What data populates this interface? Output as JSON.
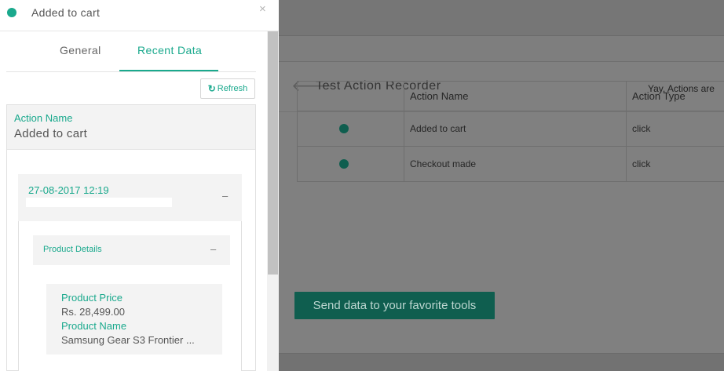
{
  "panel": {
    "title": "Added to cart",
    "close": "×",
    "tabs": [
      "General",
      "Recent Data"
    ],
    "refresh_label": "Refresh",
    "action_name_label": "Action Name",
    "action_name_value": "Added to cart",
    "entry": {
      "timestamp": "27-08-2017 12:19",
      "toggle": "–",
      "section": {
        "title": "Product Details",
        "toggle": "–",
        "fields": [
          {
            "label": "Product Price",
            "value": "Rs. 28,499.00"
          },
          {
            "label": "Product Name",
            "value": "Samsung Gear S3 Frontier ..."
          }
        ]
      }
    }
  },
  "page": {
    "title": "Test Action Recorder",
    "status": "Yay, Actions are",
    "table": {
      "headers": [
        "",
        "Action Name",
        "Action Type"
      ],
      "rows": [
        {
          "name": "Added to cart",
          "type": "click"
        },
        {
          "name": "Checkout made",
          "type": "click"
        }
      ]
    },
    "send_button": "Send data to your favorite tools"
  },
  "colors": {
    "accent": "#1aa98d",
    "dimmed_accent": "#0f5e4f",
    "overlay": "#7e7e7e"
  }
}
